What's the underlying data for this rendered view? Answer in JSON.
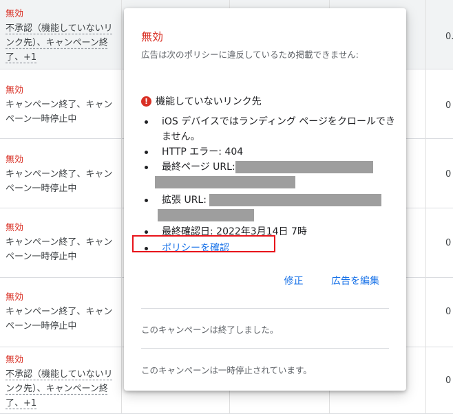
{
  "rows": [
    {
      "status": "無効",
      "reason_lines": [
        "不承認（機能していないリ",
        "ンク先）、キャンペーン終",
        "了、+1"
      ],
      "dashed": true,
      "shaded": true
    },
    {
      "status": "無効",
      "reason_lines": [
        "キャンペーン終了、キャン",
        "ペーン一時停止中"
      ],
      "dashed": false,
      "shaded": false
    },
    {
      "status": "無効",
      "reason_lines": [
        "キャンペーン終了、キャン",
        "ペーン一時停止中"
      ],
      "dashed": false,
      "shaded": false
    },
    {
      "status": "無効",
      "reason_lines": [
        "キャンペーン終了、キャン",
        "ペーン一時停止中"
      ],
      "dashed": false,
      "shaded": false
    },
    {
      "status": "無効",
      "reason_lines": [
        "キャンペーン終了、キャン",
        "ペーン一時停止中"
      ],
      "dashed": false,
      "shaded": false
    },
    {
      "status": "無効",
      "reason_lines": [
        "不承認（機能していないリ",
        "ンク先）、キャンペーン終",
        "了、+1"
      ],
      "dashed": true,
      "shaded": false
    }
  ],
  "number_cells": [
    "0.",
    "0",
    "0",
    "0",
    "0",
    "0"
  ],
  "popup": {
    "title": "無効",
    "description": "広告は次のポリシーに違反しているため掲載できません:",
    "heading": "機能していないリンク先",
    "error_icon": "!",
    "items": {
      "ios": "iOS デバイスではランディング ページをクロールできません。",
      "http": "HTTP エラー: 404",
      "final_url_label": "最終ページ URL:",
      "ext_url_label": "拡張 URL:",
      "last_checked": "最終確認日: 2022年3月14日 7時",
      "policy_link": "ポリシーを確認"
    },
    "actions": {
      "fix": "修正",
      "edit": "広告を編集"
    },
    "notes": {
      "ended": "このキャンペーンは終了しました。",
      "paused": "このキャンペーンは一時停止されています。"
    }
  },
  "colors": {
    "error": "#d93025",
    "link": "#1a73e8",
    "highlight": "#e8131a"
  }
}
